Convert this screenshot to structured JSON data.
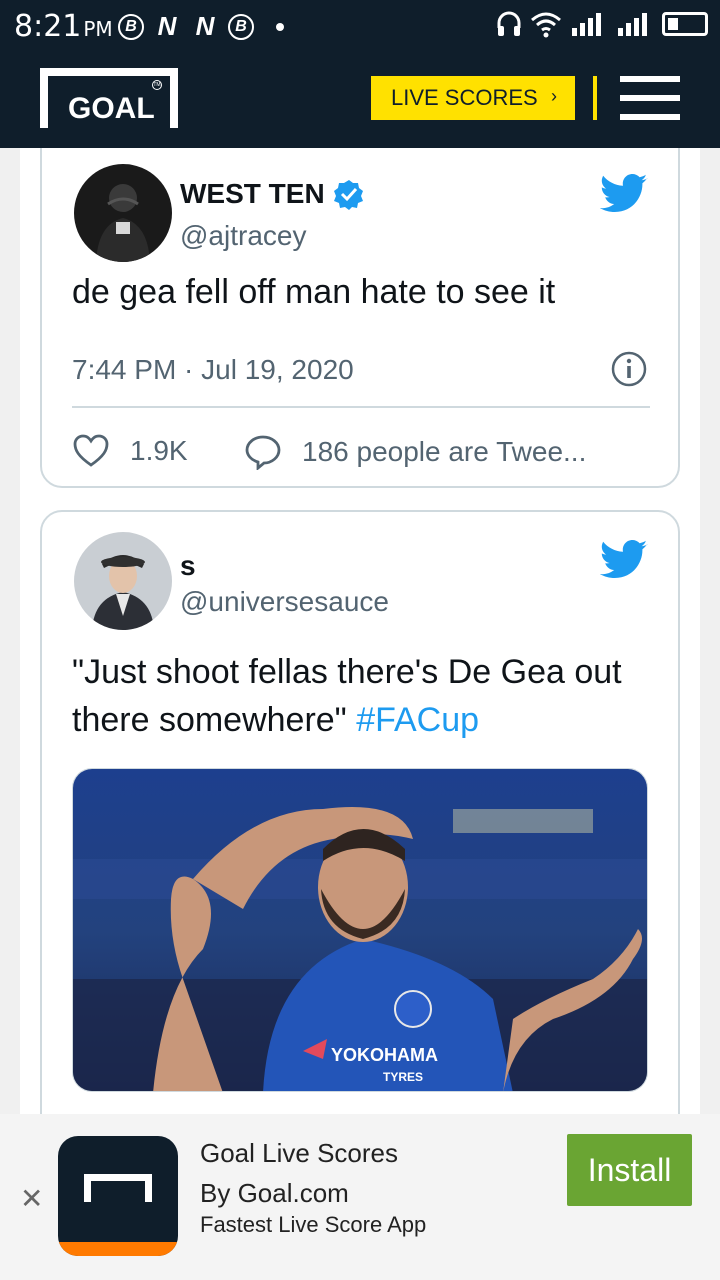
{
  "status_bar": {
    "time": "8:21",
    "ampm": "PM",
    "left_icons": [
      "b-circle-icon",
      "n-icon",
      "n-icon",
      "b-circle-icon",
      "dot-icon"
    ],
    "right_icons": [
      "headphones-icon",
      "wifi-icon",
      "signal-icon",
      "signal-icon",
      "battery-icon"
    ]
  },
  "header": {
    "logo_text": "GOAL",
    "logo_tm": "TM",
    "live_scores_label": "LIVE SCORES",
    "live_scores_chevron": "›",
    "accent_color": "#ffe100",
    "background": "#0f1e2b"
  },
  "tweets": [
    {
      "name": "WEST TEN",
      "verified": true,
      "handle": "@ajtracey",
      "text": "de gea fell off man hate to see it",
      "timestamp": "7:44 PM · Jul 19, 2020",
      "likes": "1.9K",
      "replies_label": "186 people are Twee..."
    },
    {
      "name": "s",
      "verified": false,
      "handle": "@universesauce",
      "text_before": "\"Just shoot fellas there's De Gea out there somewhere\" ",
      "hashtag": "#FACup"
    }
  ],
  "ad": {
    "close": "✕",
    "title": "Goal Live Scores",
    "publisher": "By Goal.com",
    "description": "Fastest Live Score App",
    "install_label": "Install",
    "install_color": "#6aa533"
  }
}
